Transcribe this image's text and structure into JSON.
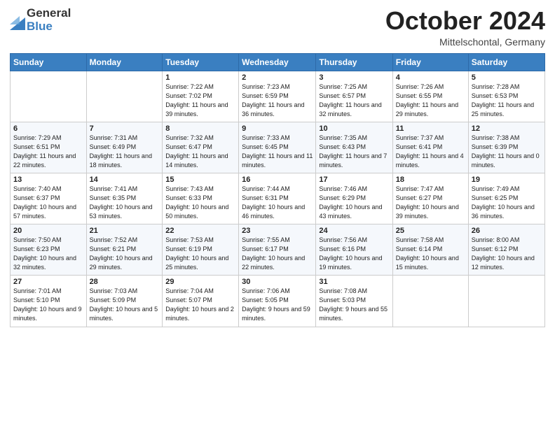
{
  "logo": {
    "general": "General",
    "blue": "Blue"
  },
  "title": "October 2024",
  "location": "Mittelschontal, Germany",
  "days_of_week": [
    "Sunday",
    "Monday",
    "Tuesday",
    "Wednesday",
    "Thursday",
    "Friday",
    "Saturday"
  ],
  "weeks": [
    [
      {
        "day": "",
        "info": ""
      },
      {
        "day": "",
        "info": ""
      },
      {
        "day": "1",
        "info": "Sunrise: 7:22 AM\nSunset: 7:02 PM\nDaylight: 11 hours and 39 minutes."
      },
      {
        "day": "2",
        "info": "Sunrise: 7:23 AM\nSunset: 6:59 PM\nDaylight: 11 hours and 36 minutes."
      },
      {
        "day": "3",
        "info": "Sunrise: 7:25 AM\nSunset: 6:57 PM\nDaylight: 11 hours and 32 minutes."
      },
      {
        "day": "4",
        "info": "Sunrise: 7:26 AM\nSunset: 6:55 PM\nDaylight: 11 hours and 29 minutes."
      },
      {
        "day": "5",
        "info": "Sunrise: 7:28 AM\nSunset: 6:53 PM\nDaylight: 11 hours and 25 minutes."
      }
    ],
    [
      {
        "day": "6",
        "info": "Sunrise: 7:29 AM\nSunset: 6:51 PM\nDaylight: 11 hours and 22 minutes."
      },
      {
        "day": "7",
        "info": "Sunrise: 7:31 AM\nSunset: 6:49 PM\nDaylight: 11 hours and 18 minutes."
      },
      {
        "day": "8",
        "info": "Sunrise: 7:32 AM\nSunset: 6:47 PM\nDaylight: 11 hours and 14 minutes."
      },
      {
        "day": "9",
        "info": "Sunrise: 7:33 AM\nSunset: 6:45 PM\nDaylight: 11 hours and 11 minutes."
      },
      {
        "day": "10",
        "info": "Sunrise: 7:35 AM\nSunset: 6:43 PM\nDaylight: 11 hours and 7 minutes."
      },
      {
        "day": "11",
        "info": "Sunrise: 7:37 AM\nSunset: 6:41 PM\nDaylight: 11 hours and 4 minutes."
      },
      {
        "day": "12",
        "info": "Sunrise: 7:38 AM\nSunset: 6:39 PM\nDaylight: 11 hours and 0 minutes."
      }
    ],
    [
      {
        "day": "13",
        "info": "Sunrise: 7:40 AM\nSunset: 6:37 PM\nDaylight: 10 hours and 57 minutes."
      },
      {
        "day": "14",
        "info": "Sunrise: 7:41 AM\nSunset: 6:35 PM\nDaylight: 10 hours and 53 minutes."
      },
      {
        "day": "15",
        "info": "Sunrise: 7:43 AM\nSunset: 6:33 PM\nDaylight: 10 hours and 50 minutes."
      },
      {
        "day": "16",
        "info": "Sunrise: 7:44 AM\nSunset: 6:31 PM\nDaylight: 10 hours and 46 minutes."
      },
      {
        "day": "17",
        "info": "Sunrise: 7:46 AM\nSunset: 6:29 PM\nDaylight: 10 hours and 43 minutes."
      },
      {
        "day": "18",
        "info": "Sunrise: 7:47 AM\nSunset: 6:27 PM\nDaylight: 10 hours and 39 minutes."
      },
      {
        "day": "19",
        "info": "Sunrise: 7:49 AM\nSunset: 6:25 PM\nDaylight: 10 hours and 36 minutes."
      }
    ],
    [
      {
        "day": "20",
        "info": "Sunrise: 7:50 AM\nSunset: 6:23 PM\nDaylight: 10 hours and 32 minutes."
      },
      {
        "day": "21",
        "info": "Sunrise: 7:52 AM\nSunset: 6:21 PM\nDaylight: 10 hours and 29 minutes."
      },
      {
        "day": "22",
        "info": "Sunrise: 7:53 AM\nSunset: 6:19 PM\nDaylight: 10 hours and 25 minutes."
      },
      {
        "day": "23",
        "info": "Sunrise: 7:55 AM\nSunset: 6:17 PM\nDaylight: 10 hours and 22 minutes."
      },
      {
        "day": "24",
        "info": "Sunrise: 7:56 AM\nSunset: 6:16 PM\nDaylight: 10 hours and 19 minutes."
      },
      {
        "day": "25",
        "info": "Sunrise: 7:58 AM\nSunset: 6:14 PM\nDaylight: 10 hours and 15 minutes."
      },
      {
        "day": "26",
        "info": "Sunrise: 8:00 AM\nSunset: 6:12 PM\nDaylight: 10 hours and 12 minutes."
      }
    ],
    [
      {
        "day": "27",
        "info": "Sunrise: 7:01 AM\nSunset: 5:10 PM\nDaylight: 10 hours and 9 minutes."
      },
      {
        "day": "28",
        "info": "Sunrise: 7:03 AM\nSunset: 5:09 PM\nDaylight: 10 hours and 5 minutes."
      },
      {
        "day": "29",
        "info": "Sunrise: 7:04 AM\nSunset: 5:07 PM\nDaylight: 10 hours and 2 minutes."
      },
      {
        "day": "30",
        "info": "Sunrise: 7:06 AM\nSunset: 5:05 PM\nDaylight: 9 hours and 59 minutes."
      },
      {
        "day": "31",
        "info": "Sunrise: 7:08 AM\nSunset: 5:03 PM\nDaylight: 9 hours and 55 minutes."
      },
      {
        "day": "",
        "info": ""
      },
      {
        "day": "",
        "info": ""
      }
    ]
  ]
}
